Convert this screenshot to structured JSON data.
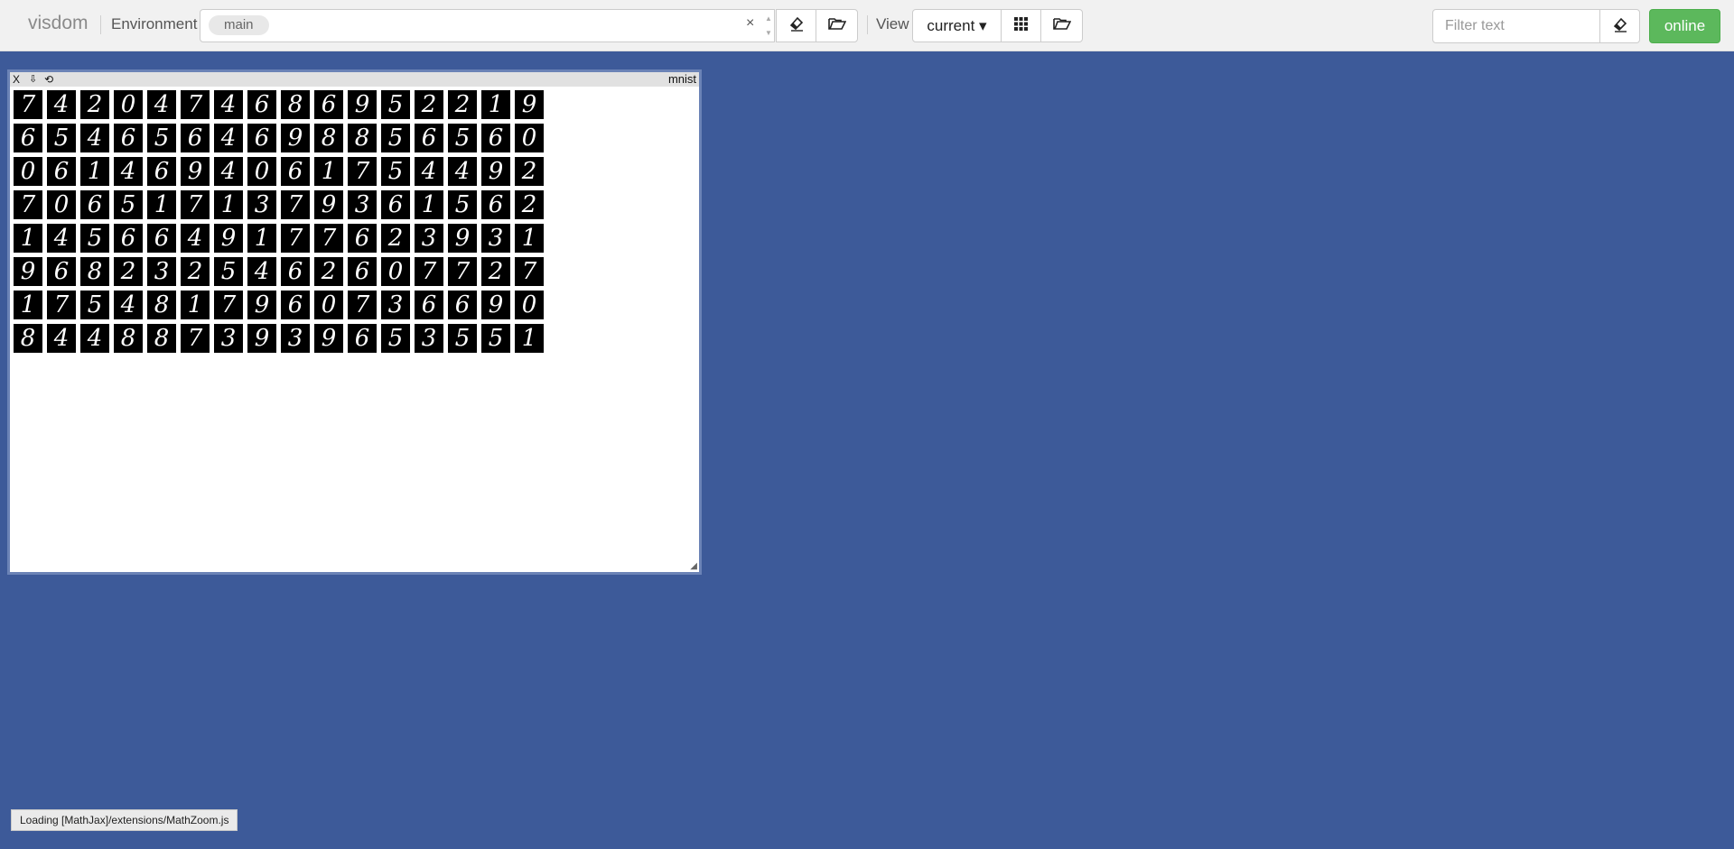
{
  "app": {
    "name": "visdom"
  },
  "environment": {
    "label": "Environment",
    "selected": "main",
    "clear_symbol": "×"
  },
  "view": {
    "label": "View",
    "selected": "current ▾"
  },
  "filter": {
    "placeholder": "Filter text"
  },
  "connection": {
    "status": "online"
  },
  "pane": {
    "title": "mnist",
    "close_label": "X",
    "download_label": "⇩",
    "reset_label": "⟲",
    "digit_rows": [
      "7420474686952219",
      "6546564698856560",
      "0614694061754492",
      "7065171379361562",
      "1456649177623931",
      "9682325462607727",
      "1754817960736690",
      "8448873939653551"
    ]
  },
  "status": {
    "text": "Loading [MathJax]/extensions/MathZoom.js"
  }
}
